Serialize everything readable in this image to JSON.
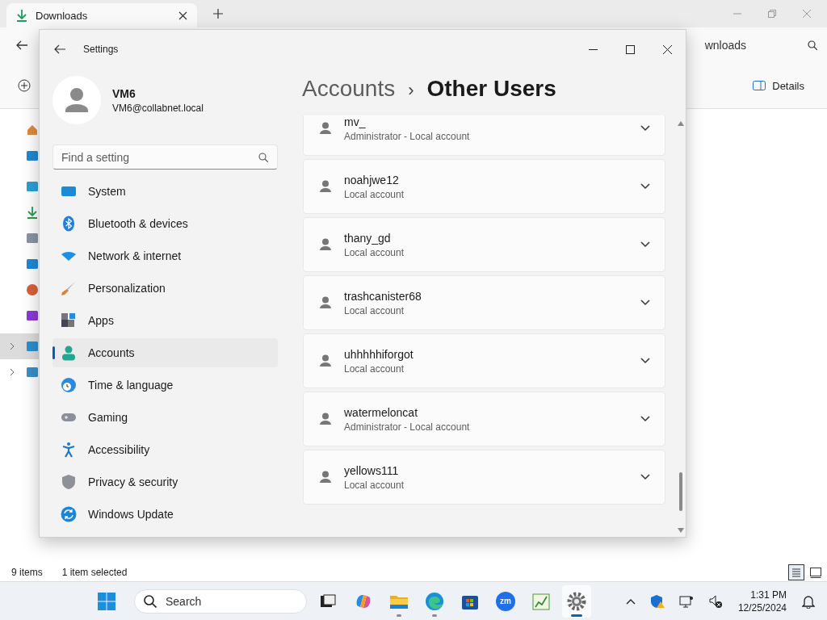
{
  "explorer": {
    "tab": {
      "title": "Downloads"
    },
    "address": "wnloads",
    "details_button": "Details",
    "tree": [
      {
        "kind": "home",
        "selected": false
      },
      {
        "kind": "gallery",
        "selected": false
      },
      {
        "kind": "desktop",
        "selected": false
      },
      {
        "kind": "download",
        "selected": false
      },
      {
        "kind": "document",
        "selected": false
      },
      {
        "kind": "gallery",
        "selected": false
      },
      {
        "kind": "music",
        "selected": false
      },
      {
        "kind": "video",
        "selected": false
      },
      {
        "kind": "pc",
        "selected": true
      },
      {
        "kind": "network",
        "selected": false
      }
    ],
    "status_bar": {
      "count": "9 items",
      "selection": "1 item selected"
    }
  },
  "settings": {
    "title": "Settings",
    "user": {
      "name": "VM6",
      "email": "VM6@collabnet.local"
    },
    "search": {
      "placeholder": "Find a setting"
    },
    "nav": [
      {
        "label": "System",
        "kind": "system",
        "selected": false
      },
      {
        "label": "Bluetooth & devices",
        "kind": "bluetooth",
        "selected": false
      },
      {
        "label": "Network & internet",
        "kind": "wifi",
        "selected": false
      },
      {
        "label": "Personalization",
        "kind": "brush",
        "selected": false
      },
      {
        "label": "Apps",
        "kind": "apps",
        "selected": false
      },
      {
        "label": "Accounts",
        "kind": "person",
        "selected": true
      },
      {
        "label": "Time & language",
        "kind": "globe",
        "selected": false
      },
      {
        "label": "Gaming",
        "kind": "gamepad",
        "selected": false
      },
      {
        "label": "Accessibility",
        "kind": "access",
        "selected": false
      },
      {
        "label": "Privacy & security",
        "kind": "shield",
        "selected": false
      },
      {
        "label": "Windows Update",
        "kind": "update",
        "selected": false
      }
    ],
    "breadcrumb": {
      "parent": "Accounts",
      "separator": "›",
      "current": "Other Users"
    },
    "users": [
      {
        "name": "mv_",
        "type": "Administrator - Local account"
      },
      {
        "name": "noahjwe12",
        "type": "Local account"
      },
      {
        "name": "thany_gd",
        "type": "Local account"
      },
      {
        "name": "trashcanister68",
        "type": "Local account"
      },
      {
        "name": "uhhhhhiforgot",
        "type": "Local account"
      },
      {
        "name": "watermeloncat",
        "type": "Administrator - Local account"
      },
      {
        "name": "yellows111",
        "type": "Local account"
      }
    ]
  },
  "taskbar": {
    "search": {
      "placeholder": "Search"
    },
    "apps": [
      {
        "kind": "taskview",
        "running": false,
        "active": false
      },
      {
        "kind": "copilot",
        "running": false,
        "active": false
      },
      {
        "kind": "folder",
        "running": true,
        "active": false
      },
      {
        "kind": "edge",
        "running": true,
        "active": false
      },
      {
        "kind": "store",
        "running": false,
        "active": false
      },
      {
        "kind": "zoom",
        "running": false,
        "active": false
      },
      {
        "kind": "chart",
        "running": false,
        "active": false
      },
      {
        "kind": "gear",
        "running": true,
        "active": true
      }
    ],
    "zoom_label": "zm",
    "time": "1:31 PM",
    "date": "12/25/2024"
  }
}
